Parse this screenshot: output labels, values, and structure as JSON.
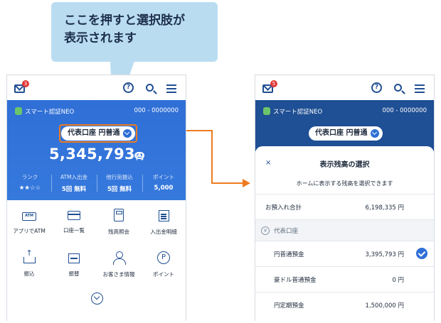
{
  "callout": {
    "text": "ここを押すと選択肢が\n表示されます"
  },
  "accent": "#2f6fd6",
  "highlight_color": "#ee7b1f",
  "left_phone": {
    "mail_badge": "3",
    "app_name": "スマート認証NEO",
    "account_number": "000 - 0000000",
    "account_select": "代表口座 円普通",
    "balance": "5,345,793",
    "balance_unit": "円",
    "stats": [
      {
        "label": "ランク",
        "value": "★★☆☆"
      },
      {
        "label": "ATM入出金",
        "value": "5回 無料"
      },
      {
        "label": "他行宛振込",
        "value": "5回 無料"
      },
      {
        "label": "ポイント",
        "value": "5,000"
      }
    ],
    "menu": [
      {
        "label": "アプリでATM",
        "icon": "atm-icon"
      },
      {
        "label": "口座一覧",
        "icon": "cards-icon"
      },
      {
        "label": "残高照会",
        "icon": "calculator-icon"
      },
      {
        "label": "入出金明細",
        "icon": "statement-icon"
      },
      {
        "label": "振込",
        "icon": "send-money-icon"
      },
      {
        "label": "振替",
        "icon": "transfer-icon"
      },
      {
        "label": "お客さま情報",
        "icon": "person-icon"
      },
      {
        "label": "ポイント",
        "icon": "point-icon"
      }
    ]
  },
  "right_phone": {
    "mail_badge": "5",
    "app_name": "スマート認証NEO",
    "account_number": "000 - 0000000",
    "account_select": "代表口座 円普通",
    "sheet": {
      "close": "×",
      "title": "表示残高の選択",
      "subtitle": "ホームに表示する残高を選択できます",
      "total_label": "お預入れ合計",
      "total_value": "6,198,335 円",
      "section_icon": "¥",
      "section_label": "代表口座",
      "rows": [
        {
          "label": "円普通預金",
          "value": "3,395,793 円",
          "selected": true
        },
        {
          "label": "豪ドル普通預金",
          "value": "0 円",
          "selected": false
        },
        {
          "label": "円定期預金",
          "value": "1,500,000 円",
          "selected": false
        }
      ]
    }
  }
}
